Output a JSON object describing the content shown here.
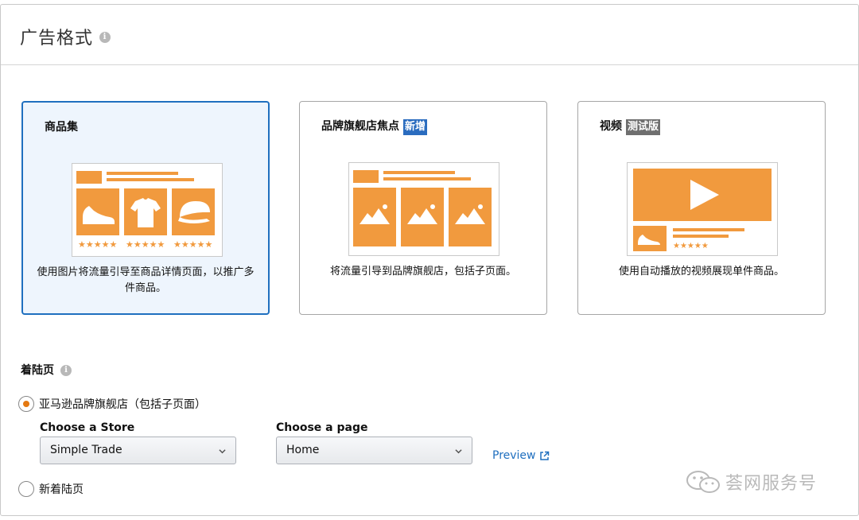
{
  "header": {
    "title": "广告格式"
  },
  "cards": [
    {
      "title": "商品集",
      "badge": "",
      "description": "使用图片将流量引导至商品详情页面，以推广多件商品。",
      "selected": true
    },
    {
      "title": "品牌旗舰店焦点",
      "badge": "新增",
      "description": "将流量引导到品牌旗舰店，包括子页面。",
      "selected": false
    },
    {
      "title": "视频",
      "badge": "测试版",
      "description": "使用自动播放的视频展现单件商品。",
      "selected": false
    }
  ],
  "landing": {
    "label": "着陆页",
    "options": [
      {
        "label": "亚马逊品牌旗舰店（包括子页面）",
        "checked": true
      },
      {
        "label": "新着陆页",
        "checked": false
      }
    ],
    "store_label": "Choose a Store",
    "store_value": "Simple Trade",
    "page_label": "Choose a page",
    "page_value": "Home",
    "preview_label": "Preview"
  },
  "watermark": "荟网服务号",
  "colors": {
    "accent_orange": "#F19A3E",
    "selected_border": "#1F6FBF",
    "selected_bg": "#EEF5FD",
    "badge_new": "#2A6CBF",
    "badge_beta": "#6F6F6F",
    "link": "#1F6FBF"
  },
  "icons": {
    "info": "info-icon",
    "chevron": "chevron-down-icon",
    "external": "external-link-icon",
    "wechat": "wechat-icon"
  }
}
